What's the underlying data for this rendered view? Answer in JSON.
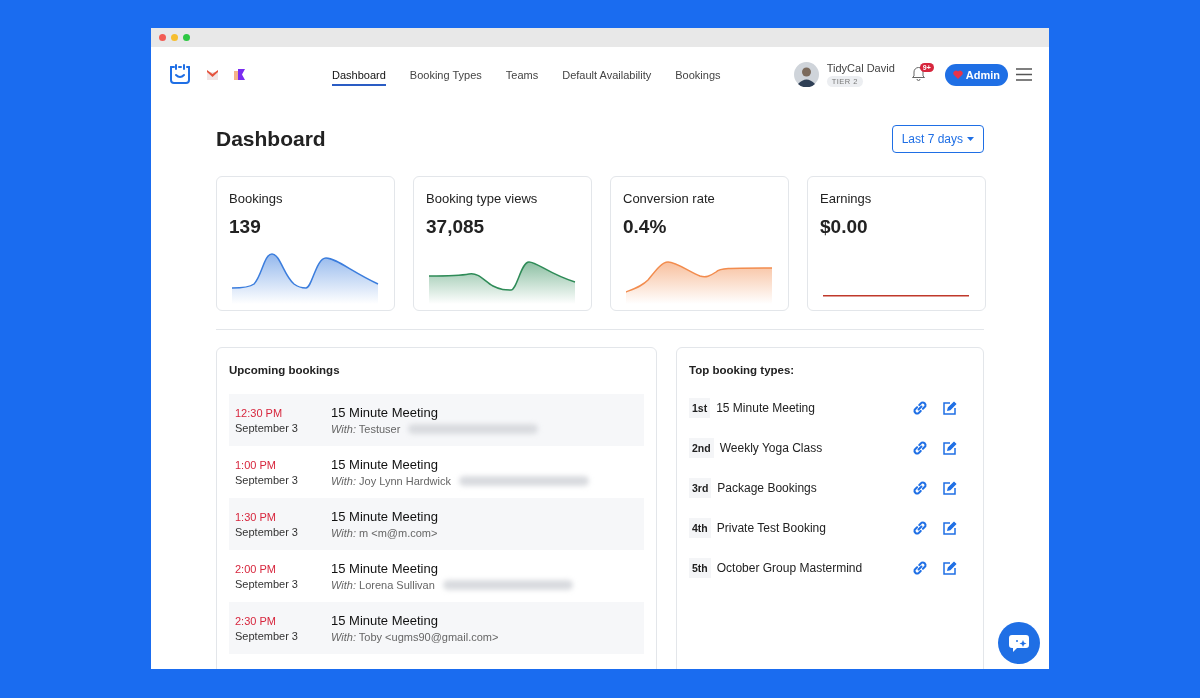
{
  "nav": {
    "tabs": [
      {
        "label": "Dashboard",
        "selected": true
      },
      {
        "label": "Booking Types",
        "selected": false
      },
      {
        "label": "Teams",
        "selected": false
      },
      {
        "label": "Default Availability",
        "selected": false
      },
      {
        "label": "Bookings",
        "selected": false
      }
    ]
  },
  "user": {
    "name": "TidyCal David",
    "tier": "TIER 2"
  },
  "notifications": {
    "badge": "9+"
  },
  "admin_button": {
    "label": "Admin"
  },
  "page": {
    "title": "Dashboard",
    "range_button": "Last 7 days"
  },
  "stats": [
    {
      "label": "Bookings",
      "value": "139",
      "color": "#3b7ddd",
      "kind": "wave"
    },
    {
      "label": "Booking type views",
      "value": "37,085",
      "color": "#2e8b57",
      "kind": "wave"
    },
    {
      "label": "Conversion rate",
      "value": "0.4%",
      "color": "#f28c4e",
      "kind": "wave"
    },
    {
      "label": "Earnings",
      "value": "$0.00",
      "color": "#c0392b",
      "kind": "flat"
    }
  ],
  "upcoming": {
    "title": "Upcoming bookings",
    "rows": [
      {
        "time": "12:30 PM",
        "date": "September 3",
        "title": "15 Minute Meeting",
        "with": "*With:* Testuser",
        "redacted": true
      },
      {
        "time": "1:00 PM",
        "date": "September 3",
        "title": "15 Minute Meeting",
        "with": "*With:* Joy Lynn Hardwick",
        "redacted": true
      },
      {
        "time": "1:30 PM",
        "date": "September 3",
        "title": "15 Minute Meeting",
        "with": "*With:* m <m@m.com>",
        "redacted": false
      },
      {
        "time": "2:00 PM",
        "date": "September 3",
        "title": "15 Minute Meeting",
        "with": "*With:* Lorena Sullivan",
        "redacted": true
      },
      {
        "time": "2:30 PM",
        "date": "September 3",
        "title": "15 Minute Meeting",
        "with": "*With:* Toby <ugms90@gmail.com>",
        "redacted": false
      }
    ]
  },
  "top_types": {
    "title": "Top booking types:",
    "items": [
      {
        "rank": "1st",
        "name": "15 Minute Meeting"
      },
      {
        "rank": "2nd",
        "name": "Weekly Yoga Class"
      },
      {
        "rank": "3rd",
        "name": "Package Bookings"
      },
      {
        "rank": "4th",
        "name": "Private Test Booking"
      },
      {
        "rank": "5th",
        "name": "October Group Mastermind"
      }
    ]
  }
}
